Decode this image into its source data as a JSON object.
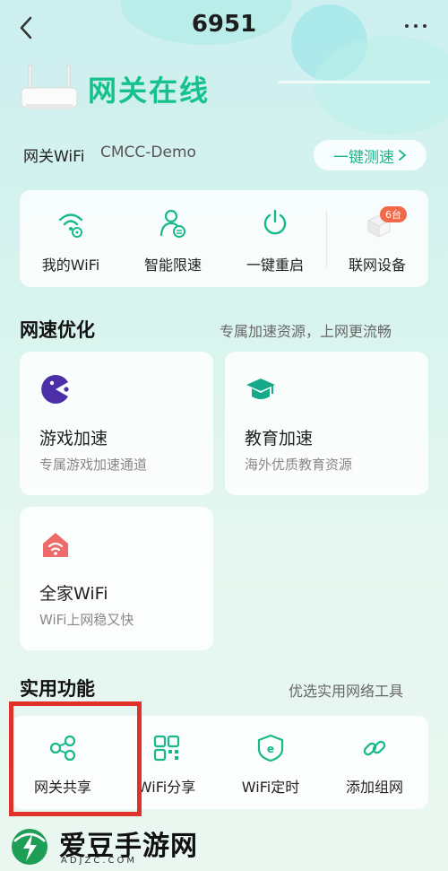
{
  "header": {
    "title": "6951"
  },
  "status": {
    "text": "网关在线"
  },
  "wifi": {
    "label": "网关WiFi",
    "name": "CMCC-Demo",
    "speedtest_label": "一键测速"
  },
  "quick_actions": [
    {
      "label": "我的WiFi",
      "icon": "wifi-lock-icon"
    },
    {
      "label": "智能限速",
      "icon": "user-speed-icon"
    },
    {
      "label": "一键重启",
      "icon": "power-icon"
    },
    {
      "label": "联网设备",
      "icon": "device-icon",
      "badge": "6台"
    }
  ],
  "speed_section": {
    "title": "网速优化",
    "subtitle": "专属加速资源，上网更流畅",
    "items": [
      {
        "title": "游戏加速",
        "subtitle": "专属游戏加速通道",
        "icon": "game-icon"
      },
      {
        "title": "教育加速",
        "subtitle": "海外优质教育资源",
        "icon": "graduation-cap-icon"
      },
      {
        "title": "全家WiFi",
        "subtitle": "WiFi上网稳又快",
        "icon": "home-wifi-icon"
      }
    ]
  },
  "tools_section": {
    "title": "实用功能",
    "subtitle": "优选实用网络工具",
    "items": [
      {
        "label": "网关共享",
        "icon": "share-icon"
      },
      {
        "label": "WiFi分享",
        "icon": "qr-code-icon"
      },
      {
        "label": "WiFi定时",
        "icon": "timer-icon"
      },
      {
        "label": "添加组网",
        "icon": "link-icon"
      }
    ]
  },
  "watermark": {
    "text": "爱豆手游网",
    "url": "ADJZC.COM"
  },
  "colors": {
    "accent": "#16c28b",
    "highlight": "#e0312a",
    "badge": "#f06a4a"
  }
}
